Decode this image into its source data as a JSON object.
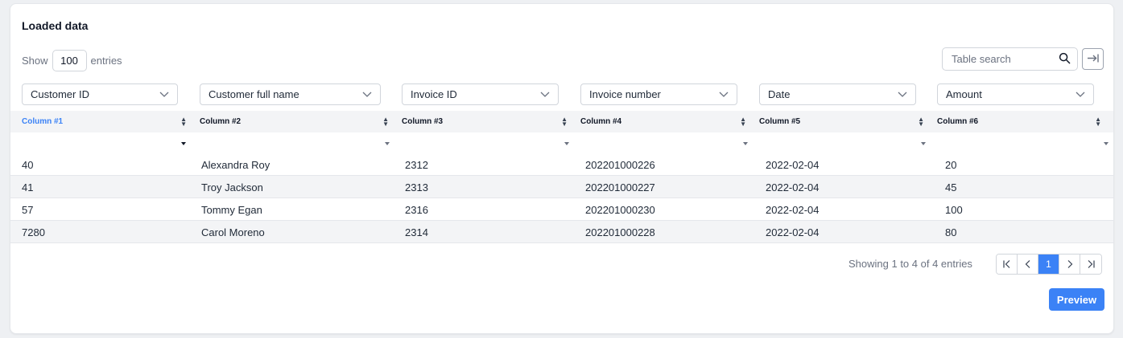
{
  "title": "Loaded data",
  "length": {
    "show_label": "Show",
    "value": "100",
    "entries_label": "entries"
  },
  "search": {
    "placeholder": "Table search"
  },
  "column_selects": [
    "Customer ID",
    "Customer full name",
    "Invoice ID",
    "Invoice number",
    "Date",
    "Amount"
  ],
  "columns": [
    "Column #1",
    "Column #2",
    "Column #3",
    "Column #4",
    "Column #5",
    "Column #6"
  ],
  "rows": [
    [
      "40",
      "Alexandra Roy",
      "2312",
      "202201000226",
      "2022-02-04",
      "20"
    ],
    [
      "41",
      "Troy Jackson",
      "2313",
      "202201000227",
      "2022-02-04",
      "45"
    ],
    [
      "57",
      "Tommy Egan",
      "2316",
      "202201000230",
      "2022-02-04",
      "100"
    ],
    [
      "7280",
      "Carol Moreno",
      "2314",
      "202201000228",
      "2022-02-04",
      "80"
    ]
  ],
  "info": "Showing 1 to 4 of 4 entries",
  "pagination": {
    "current": "1"
  },
  "preview_label": "Preview",
  "colors": {
    "accent": "#3b82f6",
    "header_bg": "#f3f4f6",
    "stripe_bg": "#f3f4f6"
  }
}
